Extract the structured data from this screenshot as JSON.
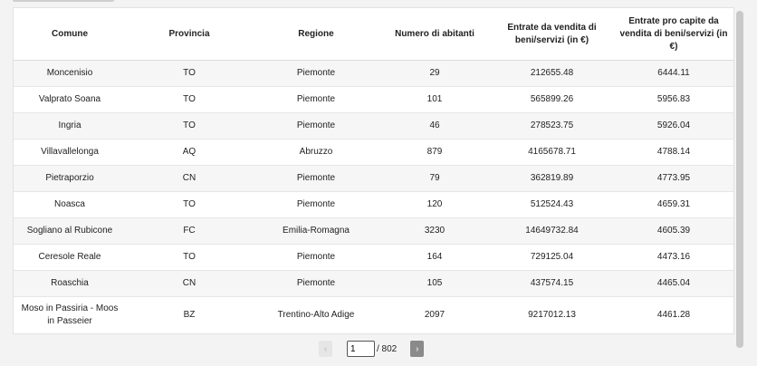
{
  "table": {
    "columns": [
      "Comune",
      "Provincia",
      "Regione",
      "Numero di abitanti",
      "Entrate da vendita di beni/servizi (in €)",
      "Entrate pro capite da vendita di beni/servizi (in €)"
    ],
    "rows": [
      [
        "Moncenisio",
        "TO",
        "Piemonte",
        "29",
        "212655.48",
        "6444.11"
      ],
      [
        "Valprato Soana",
        "TO",
        "Piemonte",
        "101",
        "565899.26",
        "5956.83"
      ],
      [
        "Ingria",
        "TO",
        "Piemonte",
        "46",
        "278523.75",
        "5926.04"
      ],
      [
        "Villavallelonga",
        "AQ",
        "Abruzzo",
        "879",
        "4165678.71",
        "4788.14"
      ],
      [
        "Pietraporzio",
        "CN",
        "Piemonte",
        "79",
        "362819.89",
        "4773.95"
      ],
      [
        "Noasca",
        "TO",
        "Piemonte",
        "120",
        "512524.43",
        "4659.31"
      ],
      [
        "Sogliano al Rubicone",
        "FC",
        "Emilia-Romagna",
        "3230",
        "14649732.84",
        "4605.39"
      ],
      [
        "Ceresole Reale",
        "TO",
        "Piemonte",
        "164",
        "729125.04",
        "4473.16"
      ],
      [
        "Roaschia",
        "CN",
        "Piemonte",
        "105",
        "437574.15",
        "4465.04"
      ],
      [
        "Moso in Passiria - Moos in Passeier",
        "BZ",
        "Trentino-Alto Adige",
        "2097",
        "9217012.13",
        "4461.28"
      ]
    ]
  },
  "pagination": {
    "prev_icon": "‹",
    "next_icon": "›",
    "current_page": "1",
    "total_label": "/ 802"
  }
}
